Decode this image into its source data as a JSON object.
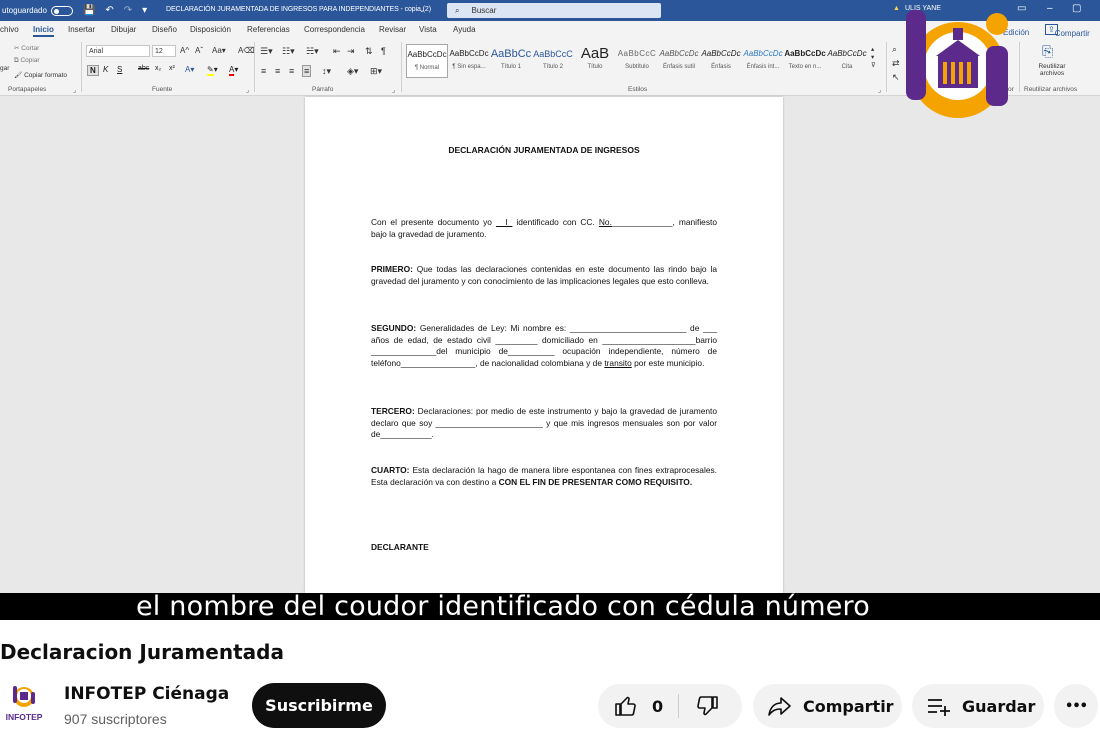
{
  "word": {
    "autosave_label": "utoguardado",
    "doc_title": "DECLARACIÓN JURAMENTADA DE INGRESOS PARA INDEPENDIANTES - copia (2)",
    "search_placeholder": "Buscar",
    "user_name": "ULIS YANE",
    "tabs": [
      "chivo",
      "Inicio",
      "Insertar",
      "Dibujar",
      "Diseño",
      "Disposición",
      "Referencias",
      "Correspondencia",
      "Revisar",
      "Vista",
      "Ayuda"
    ],
    "edit_label": "Edición",
    "share_label": "Compartir",
    "ribbon": {
      "clipboard": {
        "label": "Portapapeles",
        "paste": "gar",
        "cut": "Cortar",
        "copy": "Copiar",
        "format_painter": "Copiar formato"
      },
      "font": {
        "label": "Fuente",
        "font_name": "Arial",
        "font_size": "12",
        "bold": "N",
        "italic": "K",
        "underline": "S",
        "strike": "abc",
        "sub": "x₂",
        "sup": "x²"
      },
      "paragraph": {
        "label": "Párrafo"
      },
      "styles": {
        "label": "Estilos",
        "items": [
          {
            "preview": "AaBbCcDc",
            "name": "¶ Normal"
          },
          {
            "preview": "AaBbCcDc",
            "name": "¶ Sin espa..."
          },
          {
            "preview": "AaBbCc",
            "name": "Título 1"
          },
          {
            "preview": "AaBbCcC",
            "name": "Título 2"
          },
          {
            "preview": "AaB",
            "name": "Título"
          },
          {
            "preview": "AaBbCcC",
            "name": "Subtítulo"
          },
          {
            "preview": "AaBbCcDc",
            "name": "Énfasis sutil"
          },
          {
            "preview": "AaBbCcDc",
            "name": "Énfasis"
          },
          {
            "preview": "AaBbCcDc",
            "name": "Énfasis int..."
          },
          {
            "preview": "AaBbCcDc",
            "name": "Texto en n..."
          },
          {
            "preview": "AaBbCcDc",
            "name": "Cita"
          }
        ]
      },
      "voice_label": "or",
      "reuse": {
        "label": "Reutilizar archivos",
        "button": "Reutilizar archivos"
      }
    }
  },
  "document": {
    "title": "DECLARACIÓN JURAMENTADA DE INGRESOS",
    "intro_1": "Con el presente documento yo ",
    "intro_blank": "__I_",
    "intro_2": " identificado con CC. ",
    "intro_no": "No.",
    "intro_3": "_____________, manifiesto bajo la gravedad de juramento.",
    "primero_label": "PRIMERO:",
    "primero_text": " Que todas las declaraciones contenidas en este documento las rindo bajo la gravedad del juramento y con conocimiento de las implicaciones legales que esto conlleva.",
    "segundo_label": "SEGUNDO:",
    "segundo_text_1": " Generalidades de Ley: Mi nombre es: _________________________ de ___ años de edad, de estado civil _________ domiciliado en ____________________barrio ______________del municipio de__________ ocupación independiente, número de teléfono________________, de nacionalidad colombiana y de ",
    "segundo_transito": "transito",
    "segundo_text_2": " por este municipio.",
    "tercero_label": "TERCERO:",
    "tercero_text": " Declaraciones: por medio de este instrumento y bajo la gravedad de juramento declaro que soy _______________________ y que mis ingresos mensuales son por valor de___________.",
    "cuarto_label": "CUARTO:",
    "cuarto_text": " Esta declaración la hago de manera libre espontanea con fines extraprocesales. Esta declaración va con destino a ",
    "cuarto_bold": "CON EL FIN DE PRESENTAR COMO REQUISITO.",
    "declarante": "DECLARANTE"
  },
  "subtitle": "el nombre del coudor identificado con cédula número",
  "video": {
    "title": "Declaracion Juramentada",
    "channel_name": "INFOTEP Ciénaga",
    "subscribers": "907 suscriptores",
    "avatar_text": "INFOTEP",
    "subscribe_label": "Suscribirme",
    "like_count": "0",
    "share_label": "Compartir",
    "save_label": "Guardar",
    "more_label": "•••"
  },
  "colors": {
    "word_blue": "#2b579a",
    "logo_purple": "#5b2a8a",
    "logo_orange": "#f5a300"
  }
}
